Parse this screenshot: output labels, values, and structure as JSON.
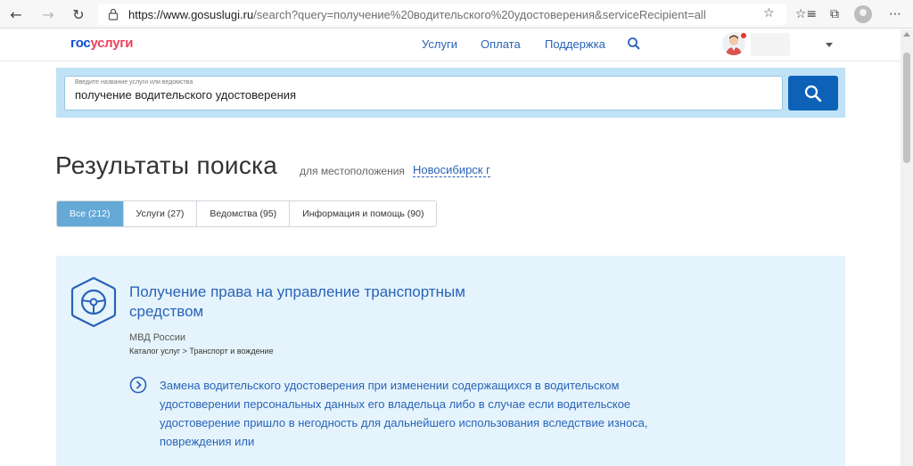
{
  "browser": {
    "url_host": "https://www.gosuslugi.ru",
    "url_rest": "/search?query=получение%20водительского%20удостоверения&serviceRecipient=all",
    "icons": [
      "back-icon",
      "forward-icon",
      "refresh-icon",
      "lock-icon",
      "star-icon",
      "favorites-icon",
      "collections-icon",
      "profile-icon"
    ]
  },
  "header": {
    "logo_part1": "гос",
    "logo_part2": "услуги",
    "menu": [
      "Услуги",
      "Оплата",
      "Поддержка"
    ]
  },
  "search": {
    "label": "Введите название услуги или ведомства",
    "value": "получение водительского удостоверения"
  },
  "results": {
    "title": "Результаты поиска",
    "for_location": "для местоположения",
    "city": "Новосибирск г"
  },
  "tabs": [
    {
      "label": "Все (212)",
      "active": true
    },
    {
      "label": "Услуги (27)",
      "active": false
    },
    {
      "label": "Ведомства (95)",
      "active": false
    },
    {
      "label": "Информация и помощь (90)",
      "active": false
    }
  ],
  "card": {
    "title": "Получение права на управление транспортным средством",
    "department": "МВД России",
    "catalog": "Каталог услуг > Транспорт и вождение",
    "sub_service": "Замена водительского удостоверения при изменении содержащихся в водительском удостоверении персональных данных его владельца либо в случае если водительское удостоверение пришло в негодность для дальнейшего использования вследствие износа, повреждения или"
  },
  "colors": {
    "brand_blue": "#0d4cd3",
    "brand_red": "#ee3f58",
    "link_blue": "#2a63b8",
    "search_panel": "#bfe2f6",
    "search_button": "#0d62b8",
    "active_tab": "#65a9d7",
    "card_bg": "#e5f4fc"
  }
}
